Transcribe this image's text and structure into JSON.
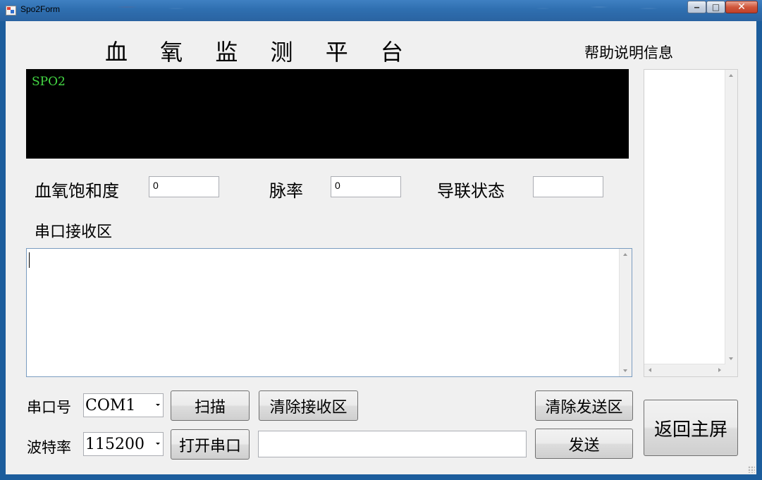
{
  "window": {
    "title": "Spo2Form"
  },
  "header": {
    "title": "血 氧 监 测 平 台",
    "help_label": "帮助说明信息"
  },
  "display": {
    "label": "SPO2"
  },
  "readings": {
    "spo2_label": "血氧饱和度",
    "spo2_value": "0",
    "pulse_label": "脉率",
    "pulse_value": "0",
    "lead_label": "导联状态",
    "lead_value": ""
  },
  "receive": {
    "label": "串口接收区",
    "content": ""
  },
  "help": {
    "content": ""
  },
  "controls": {
    "port_label": "串口号",
    "port_value": "COM1",
    "baud_label": "波特率",
    "baud_value": "115200",
    "scan_button": "扫描",
    "open_button": "打开串口",
    "clear_receive_button": "清除接收区",
    "clear_send_button": "清除发送区",
    "send_button": "发送",
    "send_input": "",
    "home_button": "返回主屏"
  }
}
